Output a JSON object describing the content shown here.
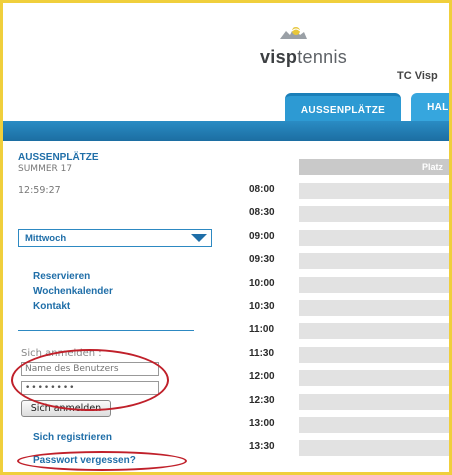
{
  "header": {
    "logo": {
      "brand_bold": "visp",
      "brand_light": "tennis"
    },
    "club_name": "TC Visp",
    "tabs": [
      {
        "label": "AUSSENPLÄTZE",
        "active": true
      },
      {
        "label": "HALL",
        "active": false
      }
    ]
  },
  "sidebar": {
    "section_title": "AUSSENPLÄTZE",
    "season": "SUMMER 17",
    "clock": "12:59:27",
    "day_select": {
      "value": "Mittwoch"
    },
    "nav": {
      "reserve": "Reservieren",
      "week_calendar": "Wochenkalender",
      "contact": "Kontakt"
    },
    "login": {
      "label": "Sich anmelden :",
      "username_placeholder": "Name des Benutzers",
      "password_value": "••••••••",
      "button": "Sich anmelden"
    },
    "register": "Sich registrieren",
    "forgot_password": "Passwort vergessen?"
  },
  "schedule": {
    "column_header": "Platz",
    "times": [
      "08:00",
      "08:30",
      "09:00",
      "09:30",
      "10:00",
      "10:30",
      "11:00",
      "11:30",
      "12:00",
      "12:30",
      "13:00",
      "13:30"
    ]
  },
  "colors": {
    "accent": "#2d9ad3",
    "link": "#1f6ea8",
    "frame": "#f0cf3c",
    "highlight_ellipse": "#c0202a"
  }
}
